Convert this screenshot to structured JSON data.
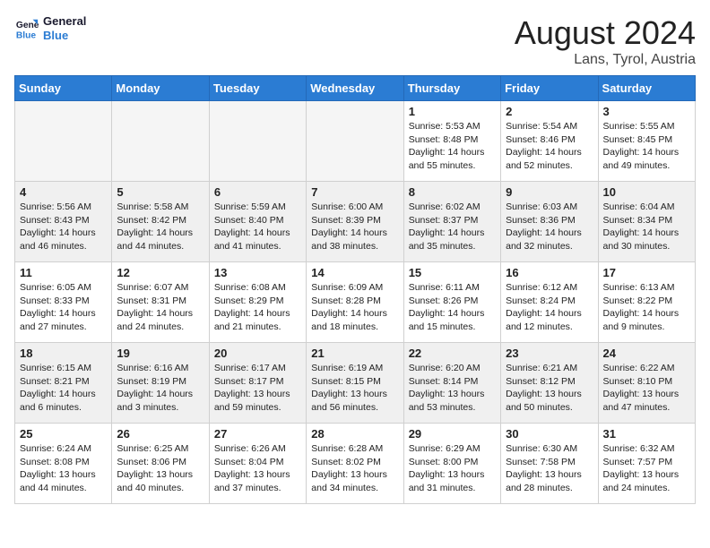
{
  "logo": {
    "line1": "General",
    "line2": "Blue"
  },
  "title": "August 2024",
  "location": "Lans, Tyrol, Austria",
  "headers": [
    "Sunday",
    "Monday",
    "Tuesday",
    "Wednesday",
    "Thursday",
    "Friday",
    "Saturday"
  ],
  "rows": [
    [
      {
        "day": "",
        "empty": true
      },
      {
        "day": "",
        "empty": true
      },
      {
        "day": "",
        "empty": true
      },
      {
        "day": "",
        "empty": true
      },
      {
        "day": "1",
        "info": "Sunrise: 5:53 AM\nSunset: 8:48 PM\nDaylight: 14 hours\nand 55 minutes."
      },
      {
        "day": "2",
        "info": "Sunrise: 5:54 AM\nSunset: 8:46 PM\nDaylight: 14 hours\nand 52 minutes."
      },
      {
        "day": "3",
        "info": "Sunrise: 5:55 AM\nSunset: 8:45 PM\nDaylight: 14 hours\nand 49 minutes."
      }
    ],
    [
      {
        "day": "4",
        "info": "Sunrise: 5:56 AM\nSunset: 8:43 PM\nDaylight: 14 hours\nand 46 minutes."
      },
      {
        "day": "5",
        "info": "Sunrise: 5:58 AM\nSunset: 8:42 PM\nDaylight: 14 hours\nand 44 minutes."
      },
      {
        "day": "6",
        "info": "Sunrise: 5:59 AM\nSunset: 8:40 PM\nDaylight: 14 hours\nand 41 minutes."
      },
      {
        "day": "7",
        "info": "Sunrise: 6:00 AM\nSunset: 8:39 PM\nDaylight: 14 hours\nand 38 minutes."
      },
      {
        "day": "8",
        "info": "Sunrise: 6:02 AM\nSunset: 8:37 PM\nDaylight: 14 hours\nand 35 minutes."
      },
      {
        "day": "9",
        "info": "Sunrise: 6:03 AM\nSunset: 8:36 PM\nDaylight: 14 hours\nand 32 minutes."
      },
      {
        "day": "10",
        "info": "Sunrise: 6:04 AM\nSunset: 8:34 PM\nDaylight: 14 hours\nand 30 minutes."
      }
    ],
    [
      {
        "day": "11",
        "info": "Sunrise: 6:05 AM\nSunset: 8:33 PM\nDaylight: 14 hours\nand 27 minutes."
      },
      {
        "day": "12",
        "info": "Sunrise: 6:07 AM\nSunset: 8:31 PM\nDaylight: 14 hours\nand 24 minutes."
      },
      {
        "day": "13",
        "info": "Sunrise: 6:08 AM\nSunset: 8:29 PM\nDaylight: 14 hours\nand 21 minutes."
      },
      {
        "day": "14",
        "info": "Sunrise: 6:09 AM\nSunset: 8:28 PM\nDaylight: 14 hours\nand 18 minutes."
      },
      {
        "day": "15",
        "info": "Sunrise: 6:11 AM\nSunset: 8:26 PM\nDaylight: 14 hours\nand 15 minutes."
      },
      {
        "day": "16",
        "info": "Sunrise: 6:12 AM\nSunset: 8:24 PM\nDaylight: 14 hours\nand 12 minutes."
      },
      {
        "day": "17",
        "info": "Sunrise: 6:13 AM\nSunset: 8:22 PM\nDaylight: 14 hours\nand 9 minutes."
      }
    ],
    [
      {
        "day": "18",
        "info": "Sunrise: 6:15 AM\nSunset: 8:21 PM\nDaylight: 14 hours\nand 6 minutes."
      },
      {
        "day": "19",
        "info": "Sunrise: 6:16 AM\nSunset: 8:19 PM\nDaylight: 14 hours\nand 3 minutes."
      },
      {
        "day": "20",
        "info": "Sunrise: 6:17 AM\nSunset: 8:17 PM\nDaylight: 13 hours\nand 59 minutes."
      },
      {
        "day": "21",
        "info": "Sunrise: 6:19 AM\nSunset: 8:15 PM\nDaylight: 13 hours\nand 56 minutes."
      },
      {
        "day": "22",
        "info": "Sunrise: 6:20 AM\nSunset: 8:14 PM\nDaylight: 13 hours\nand 53 minutes."
      },
      {
        "day": "23",
        "info": "Sunrise: 6:21 AM\nSunset: 8:12 PM\nDaylight: 13 hours\nand 50 minutes."
      },
      {
        "day": "24",
        "info": "Sunrise: 6:22 AM\nSunset: 8:10 PM\nDaylight: 13 hours\nand 47 minutes."
      }
    ],
    [
      {
        "day": "25",
        "info": "Sunrise: 6:24 AM\nSunset: 8:08 PM\nDaylight: 13 hours\nand 44 minutes."
      },
      {
        "day": "26",
        "info": "Sunrise: 6:25 AM\nSunset: 8:06 PM\nDaylight: 13 hours\nand 40 minutes."
      },
      {
        "day": "27",
        "info": "Sunrise: 6:26 AM\nSunset: 8:04 PM\nDaylight: 13 hours\nand 37 minutes."
      },
      {
        "day": "28",
        "info": "Sunrise: 6:28 AM\nSunset: 8:02 PM\nDaylight: 13 hours\nand 34 minutes."
      },
      {
        "day": "29",
        "info": "Sunrise: 6:29 AM\nSunset: 8:00 PM\nDaylight: 13 hours\nand 31 minutes."
      },
      {
        "day": "30",
        "info": "Sunrise: 6:30 AM\nSunset: 7:58 PM\nDaylight: 13 hours\nand 28 minutes."
      },
      {
        "day": "31",
        "info": "Sunrise: 6:32 AM\nSunset: 7:57 PM\nDaylight: 13 hours\nand 24 minutes."
      }
    ]
  ]
}
